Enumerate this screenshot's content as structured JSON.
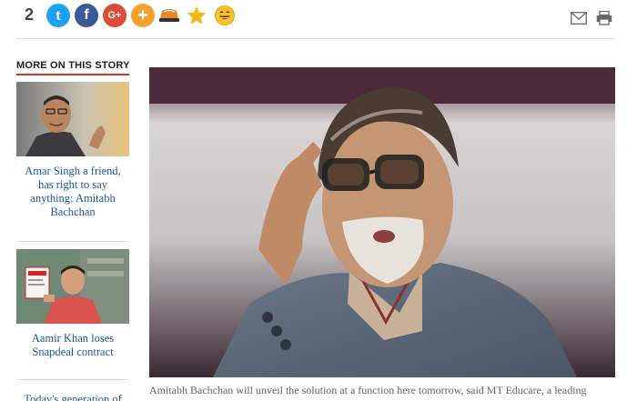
{
  "share": {
    "count": "2",
    "twitter_glyph": "t",
    "facebook_glyph": "f",
    "google_glyph": "G+",
    "more_glyph": "+",
    "icons": [
      "twitter-icon",
      "facebook-icon",
      "google-plus-icon",
      "plus-icon",
      "hat-icon",
      "star-icon",
      "laugh-icon",
      "mail-icon",
      "print-icon"
    ],
    "colors": {
      "twitter": "#1da1f2",
      "facebook": "#3b5998",
      "google": "#dd4b39",
      "more": "#f4a12f",
      "star": "#f5b91b"
    }
  },
  "sidebar": {
    "title": "MORE ON THIS STORY",
    "accent": "#c0392b",
    "stories": [
      {
        "headline": "Amar Singh a friend, has right to say anything: Amitabh Bachchan"
      },
      {
        "headline": "Aamir Khan loses Snapdeal contract"
      },
      {
        "headline": "Today's generation of"
      }
    ]
  },
  "article": {
    "caption": "Amitabh Bachchan will unveil the solution at a function here tomorrow, said MT Educare, a leading education company which is listed on BSE and NSE. (PTI)"
  }
}
